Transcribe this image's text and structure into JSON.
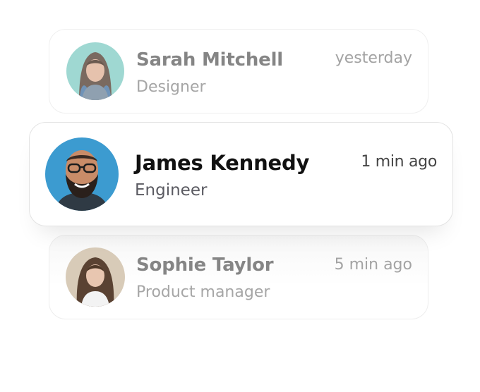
{
  "contacts": [
    {
      "name": "Sarah Mitchell",
      "role": "Designer",
      "time": "yesterday",
      "avatar_bg": "#9fd8d2"
    },
    {
      "name": "James Kennedy",
      "role": "Engineer",
      "time": "1 min ago",
      "avatar_bg": "#3c9bd0"
    },
    {
      "name": "Sophie Taylor",
      "role": "Product manager",
      "time": "5 min ago",
      "avatar_bg": "#d8cbb8"
    }
  ]
}
